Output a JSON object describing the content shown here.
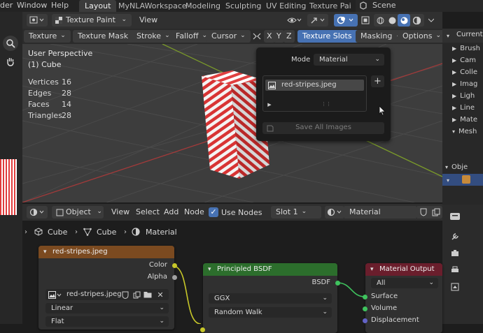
{
  "topbar": {
    "menu_partial": "der",
    "window": "Window",
    "help": "Help",
    "workspaces": [
      "Layout",
      "MyNLAWorkspace",
      "Modeling",
      "Sculpting",
      "UV Editing",
      "Texture Pai"
    ],
    "scene": "Scene"
  },
  "viewport_header": {
    "mode": "Texture Paint",
    "view": "View"
  },
  "viewport_header2": {
    "texture": "Texture",
    "texture_mask": "Texture Mask",
    "stroke": "Stroke",
    "falloff": "Falloff",
    "cursor": "Cursor",
    "x": "X",
    "y": "Y",
    "z": "Z",
    "texture_slots": "Texture Slots",
    "masking": "Masking",
    "options": "Options"
  },
  "overlay": {
    "perspective": "User Perspective",
    "object": "(1) Cube",
    "stats": [
      {
        "label": "Vertices",
        "value": "16"
      },
      {
        "label": "Edges",
        "value": "28"
      },
      {
        "label": "Faces",
        "value": "14"
      },
      {
        "label": "Triangles",
        "value": "28"
      }
    ]
  },
  "popup": {
    "mode_label": "Mode",
    "mode_value": "Material",
    "slot_item": "red-stripes.jpeg",
    "save_all": "Save All Images"
  },
  "outliner": {
    "header": "Current F",
    "items": [
      "Brush",
      "Cam",
      "Colle",
      "Imag",
      "Ligh",
      "Line",
      "Mate",
      "Mesh"
    ],
    "objects": "Obje"
  },
  "node_header": {
    "object": "Object",
    "view": "View",
    "select": "Select",
    "add": "Add",
    "node": "Node",
    "use_nodes": "Use Nodes",
    "slot": "Slot 1",
    "material": "Material"
  },
  "breadcrumb": [
    "Cube",
    "Cube",
    "Material"
  ],
  "nodes": {
    "image": {
      "title": "red-stripes.jpeg",
      "out_color": "Color",
      "out_alpha": "Alpha",
      "image_name": "red-stripes.jpeg",
      "interpolation": "Linear",
      "projection": "Flat"
    },
    "bsdf": {
      "title": "Principled BSDF",
      "out": "BSDF",
      "distribution": "GGX",
      "subsurface": "Random Walk"
    },
    "output": {
      "title": "Material Output",
      "target": "All",
      "in_surface": "Surface",
      "in_volume": "Volume",
      "in_displacement": "Displacement"
    }
  },
  "colors": {
    "accent": "#4772b3",
    "image_node": "#7b4a20",
    "shader_node": "#2c6e2c",
    "output_node": "#6a1e2c",
    "socket_yellow": "#c7c729",
    "socket_green": "#3fc35e",
    "socket_blue": "#6363c7"
  }
}
